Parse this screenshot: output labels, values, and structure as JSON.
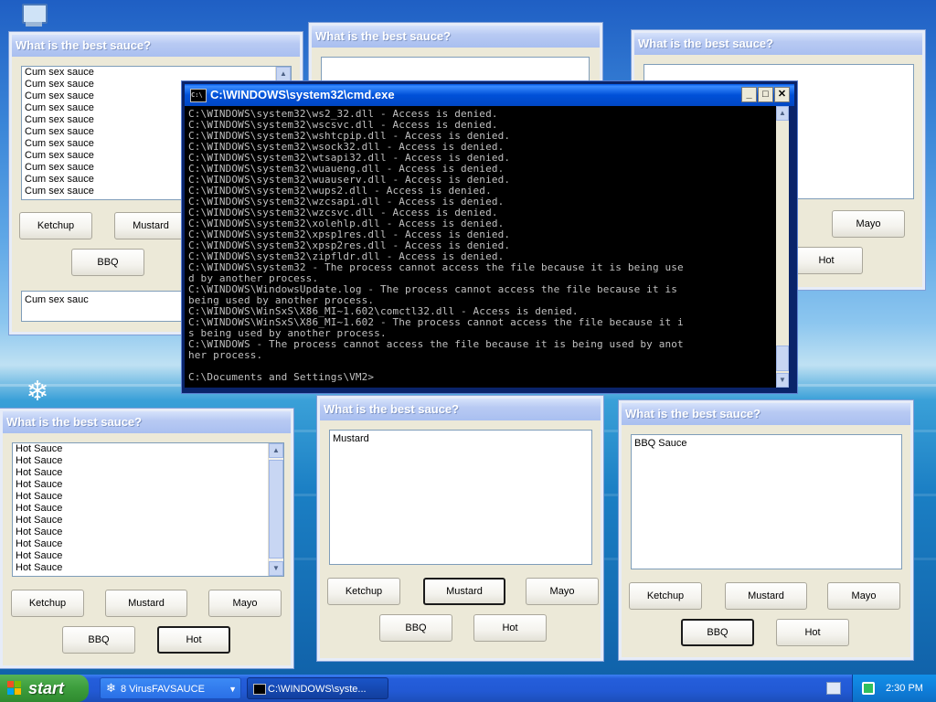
{
  "desktop": {
    "icons": [
      "my-computer-icon",
      "snowflake-icon"
    ]
  },
  "sauce_windows": [
    {
      "title": "What is the best sauce?",
      "list_items": [
        "Cum sex sauce",
        "Cum sex sauce",
        "Cum sex sauce",
        "Cum sex sauce",
        "Cum sex sauce",
        "Cum sex sauce",
        "Cum sex sauce",
        "Cum sex sauce",
        "Cum sex sauce",
        "Cum sex sauce",
        "Cum sex sauce"
      ],
      "text_value": "Cum sex sauc",
      "buttons": {
        "ketchup": "Ketchup",
        "mustard": "Mustard",
        "bbq": "BBQ"
      }
    },
    {
      "title": "What is the best sauce?"
    },
    {
      "title": "What is the best sauce?",
      "buttons": {
        "mayo": "Mayo",
        "hot": "Hot"
      }
    },
    {
      "title": "What is the best sauce?",
      "list_items": [
        "Hot Sauce",
        "Hot Sauce",
        "Hot Sauce",
        "Hot Sauce",
        "Hot Sauce",
        "Hot Sauce",
        "Hot Sauce",
        "Hot Sauce",
        "Hot Sauce",
        "Hot Sauce",
        "Hot Sauce"
      ],
      "buttons": {
        "ketchup": "Ketchup",
        "mustard": "Mustard",
        "mayo": "Mayo",
        "bbq": "BBQ",
        "hot": "Hot"
      }
    },
    {
      "title": "What is the best sauce?",
      "text_value": "Mustard",
      "buttons": {
        "ketchup": "Ketchup",
        "mustard": "Mustard",
        "mayo": "Mayo",
        "bbq": "BBQ",
        "hot": "Hot"
      }
    },
    {
      "title": "What is the best sauce?",
      "text_value": "BBQ Sauce",
      "buttons": {
        "ketchup": "Ketchup",
        "mustard": "Mustard",
        "mayo": "Mayo",
        "bbq": "BBQ",
        "hot": "Hot"
      }
    }
  ],
  "cmd": {
    "title": "C:\\WINDOWS\\system32\\cmd.exe",
    "lines": [
      "C:\\WINDOWS\\system32\\ws2_32.dll - Access is denied.",
      "C:\\WINDOWS\\system32\\wscsvc.dll - Access is denied.",
      "C:\\WINDOWS\\system32\\wshtcpip.dll - Access is denied.",
      "C:\\WINDOWS\\system32\\wsock32.dll - Access is denied.",
      "C:\\WINDOWS\\system32\\wtsapi32.dll - Access is denied.",
      "C:\\WINDOWS\\system32\\wuaueng.dll - Access is denied.",
      "C:\\WINDOWS\\system32\\wuauserv.dll - Access is denied.",
      "C:\\WINDOWS\\system32\\wups2.dll - Access is denied.",
      "C:\\WINDOWS\\system32\\wzcsapi.dll - Access is denied.",
      "C:\\WINDOWS\\system32\\wzcsvc.dll - Access is denied.",
      "C:\\WINDOWS\\system32\\xolehlp.dll - Access is denied.",
      "C:\\WINDOWS\\system32\\xpsp1res.dll - Access is denied.",
      "C:\\WINDOWS\\system32\\xpsp2res.dll - Access is denied.",
      "C:\\WINDOWS\\system32\\zipfldr.dll - Access is denied.",
      "C:\\WINDOWS\\system32 - The process cannot access the file because it is being use",
      "d by another process.",
      "C:\\WINDOWS\\WindowsUpdate.log - The process cannot access the file because it is",
      "being used by another process.",
      "C:\\WINDOWS\\WinSxS\\X86_MI~1.602\\comctl32.dll - Access is denied.",
      "C:\\WINDOWS\\WinSxS\\X86_MI~1.602 - The process cannot access the file because it i",
      "s being used by another process.",
      "C:\\WINDOWS - The process cannot access the file because it is being used by anot",
      "her process.",
      "",
      "C:\\Documents and Settings\\VM2>"
    ]
  },
  "taskbar": {
    "start_label": "start",
    "items": [
      {
        "label": "8 VirusFAVSAUCE",
        "icon": "snowflake-icon"
      },
      {
        "label": "C:\\WINDOWS\\syste...",
        "icon": "cmd-icon"
      }
    ],
    "clock": "2:30 PM"
  }
}
